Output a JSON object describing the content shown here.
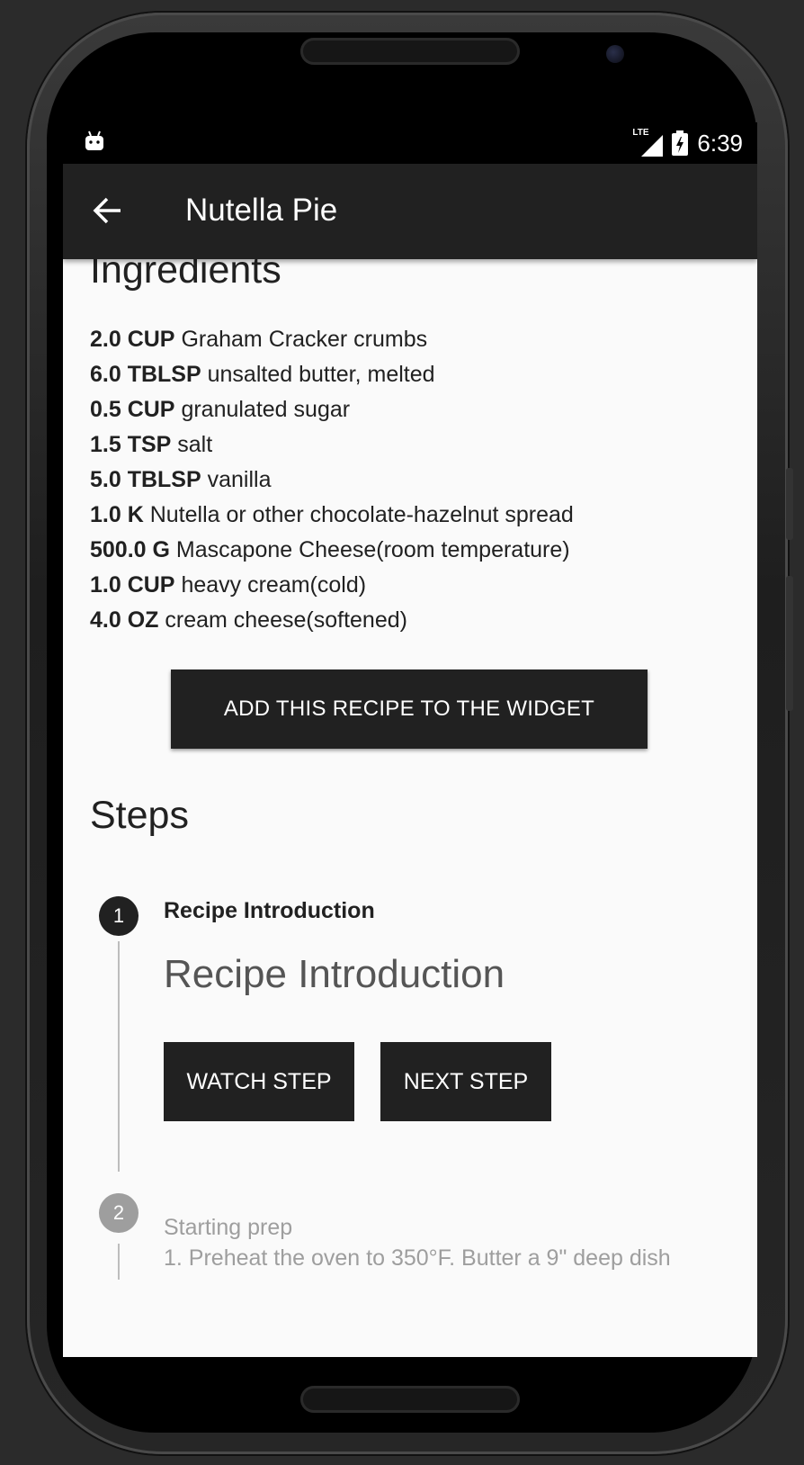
{
  "status_bar": {
    "network": "LTE",
    "time": "6:39"
  },
  "app_bar": {
    "title": "Nutella Pie",
    "back_icon": "arrow-back-icon"
  },
  "ingredients": {
    "title": "Ingredients",
    "items": [
      {
        "qty": "2.0 CUP",
        "name": "Graham Cracker crumbs"
      },
      {
        "qty": "6.0 TBLSP",
        "name": "unsalted butter, melted"
      },
      {
        "qty": "0.5 CUP",
        "name": "granulated sugar"
      },
      {
        "qty": "1.5 TSP",
        "name": "salt"
      },
      {
        "qty": "5.0 TBLSP",
        "name": "vanilla"
      },
      {
        "qty": "1.0 K",
        "name": "Nutella or other chocolate-hazelnut spread"
      },
      {
        "qty": "500.0 G",
        "name": "Mascapone Cheese(room temperature)"
      },
      {
        "qty": "1.0 CUP",
        "name": "heavy cream(cold)"
      },
      {
        "qty": "4.0 OZ",
        "name": "cream cheese(softened)"
      }
    ],
    "widget_button": "ADD THIS RECIPE TO THE WIDGET"
  },
  "steps": {
    "title": "Steps",
    "items": [
      {
        "number": "1",
        "title": "Recipe Introduction",
        "heading": "Recipe Introduction",
        "watch_label": "WATCH STEP",
        "next_label": "NEXT STEP"
      },
      {
        "number": "2",
        "title": "Starting prep",
        "description": "1. Preheat the oven to 350°F. Butter a 9\" deep dish"
      }
    ]
  },
  "colors": {
    "app_bar": "#212121",
    "button": "#212121",
    "background": "#fafafa",
    "inactive": "#9e9e9e"
  },
  "nav_icons": [
    "back-triangle-icon",
    "home-circle-icon",
    "recents-square-icon"
  ]
}
